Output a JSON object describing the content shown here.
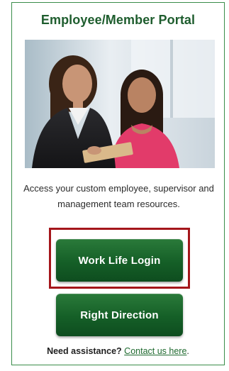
{
  "portal": {
    "title": "Employee/Member Portal",
    "description": "Access your custom employee, supervisor and management team resources.",
    "colors": {
      "brand_green": "#1e5d2e",
      "button_green": "#155f27",
      "highlight_red": "#a4161b",
      "border_green": "#3a8d4a"
    }
  },
  "buttons": {
    "work_life_login": "Work Life Login",
    "right_direction": "Right Direction"
  },
  "help": {
    "question": "Need assistance?",
    "link_text": "Contact us here",
    "suffix": "."
  }
}
